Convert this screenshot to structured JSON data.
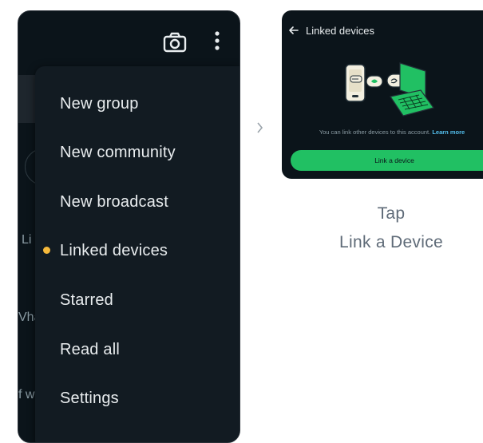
{
  "phone_menu": {
    "items": [
      {
        "label": "New group"
      },
      {
        "label": "New community"
      },
      {
        "label": "New broadcast"
      },
      {
        "label": "Linked devices",
        "highlighted": true
      },
      {
        "label": "Starred"
      },
      {
        "label": "Read all"
      },
      {
        "label": "Settings"
      }
    ],
    "behind_text": [
      "Li",
      "Vha",
      "f w"
    ]
  },
  "icons": {
    "camera": "camera-icon",
    "more": "more-vertical-icon",
    "back": "arrow-left-icon",
    "next": "chevron-right-icon"
  },
  "preview": {
    "title": "Linked devices",
    "description": "You can link other devices to this account.",
    "learn_more": "Learn more",
    "button": "Link a device"
  },
  "caption": {
    "line1": "Tap",
    "line2": "Link a Device"
  },
  "colors": {
    "dark_bg": "#0b141a",
    "menu_bg": "#121b22",
    "accent_green": "#21c063",
    "highlight_dot": "#f5b93b",
    "link_blue": "#53bdeb"
  }
}
